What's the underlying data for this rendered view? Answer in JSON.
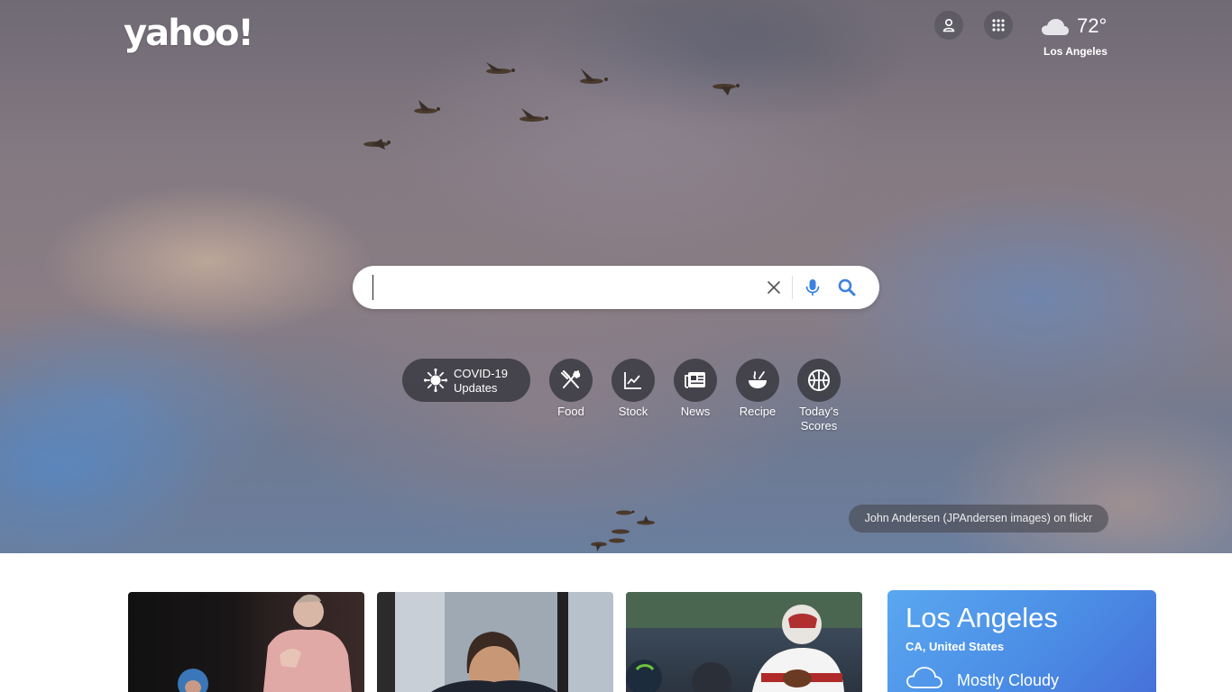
{
  "brand": {
    "logo_text": "yahoo!"
  },
  "header": {
    "profile_icon": "user-icon",
    "apps_icon": "grid-icon",
    "weather": {
      "icon": "cloud-icon",
      "temperature": "72°",
      "city": "Los Angeles"
    }
  },
  "search": {
    "value": "",
    "placeholder": "",
    "clear_icon": "close-icon",
    "mic_icon": "microphone-icon",
    "search_icon": "search-icon"
  },
  "shortcuts": [
    {
      "id": "covid",
      "label": "COVID-19\nUpdates",
      "icon": "virus-icon"
    },
    {
      "id": "food",
      "label": "Food",
      "icon": "utensils-icon"
    },
    {
      "id": "stock",
      "label": "Stock",
      "icon": "chart-line-icon"
    },
    {
      "id": "news",
      "label": "News",
      "icon": "newspaper-icon"
    },
    {
      "id": "recipe",
      "label": "Recipe",
      "icon": "bowl-icon"
    },
    {
      "id": "scores",
      "label": "Today's\nScores",
      "icon": "ball-icon"
    }
  ],
  "photo_credit": "John Andersen (JPAndersen images) on flickr",
  "weather_card": {
    "city": "Los Angeles",
    "region": "CA, United States",
    "condition": "Mostly Cloudy",
    "icon": "cloud-icon"
  },
  "colors": {
    "weather_card_start": "#5aa7f0",
    "weather_card_end": "#4671d8",
    "search_accent": "#3b82e0"
  }
}
